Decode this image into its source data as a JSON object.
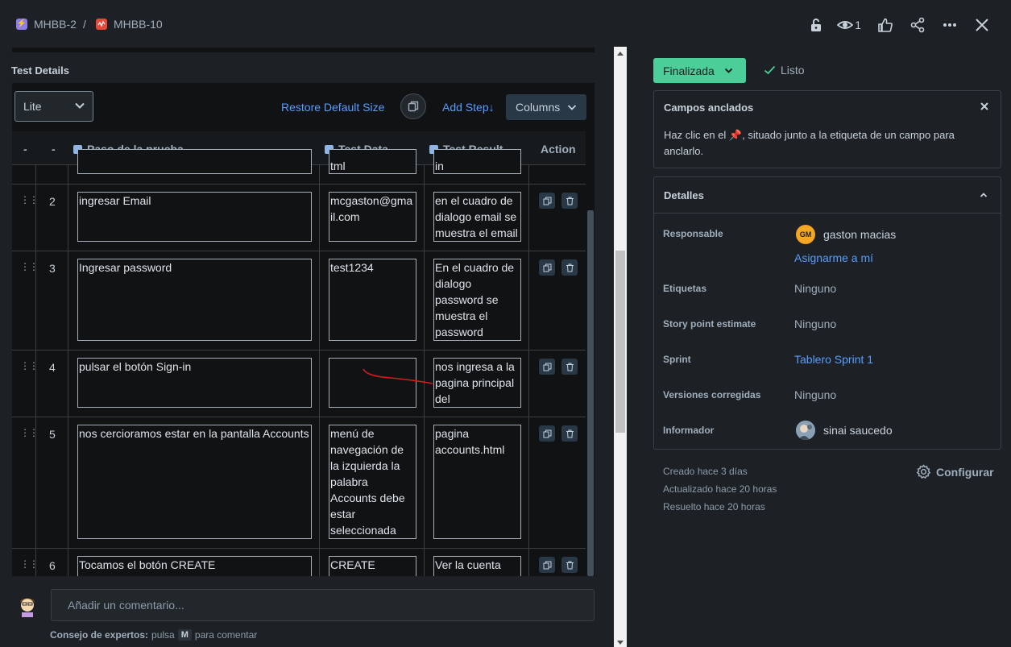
{
  "breadcrumb": {
    "parent": "MHBB-2",
    "separator": "/",
    "current": "MHBB-10",
    "parent_icon": "epic-lightning-icon",
    "current_icon": "bug-icon"
  },
  "top_actions": {
    "watch_count": "1"
  },
  "test_details": {
    "title": "Test Details",
    "view_select": "Lite",
    "restore_label": "Restore Default Size",
    "add_step_label": "Add Step↓",
    "columns_label": "Columns",
    "headers": {
      "col_drag": "-",
      "col_num": "-",
      "step": "Paso de la prueba",
      "data": "Test Data",
      "result": "Test Result",
      "action": "Action"
    },
    "partial_row": {
      "data": "tml",
      "result": "in"
    },
    "rows": [
      {
        "num": "2",
        "step": "ingresar Email",
        "data": "mcgaston@gmail.com",
        "result": "en el cuadro de dialogo email se muestra el email"
      },
      {
        "num": "3",
        "step": "Ingresar password",
        "data": "test1234",
        "result": "En el cuadro de dialogo password se muestra el password"
      },
      {
        "num": "4",
        "step": "pulsar el botón Sign-in",
        "data": "",
        "result": "nos ingresa a la pagina principal del homebanking"
      },
      {
        "num": "5",
        "step": "nos cercioramos estar en la pantalla Accounts",
        "data": "menú de navegación de la izquierda la palabra Accounts debe estar seleccionada",
        "result": "pagina accounts.html"
      },
      {
        "num": "6",
        "step": "Tocamos el botón CREATE",
        "data": "CREATE",
        "result": "Ver la cuenta"
      }
    ]
  },
  "comment": {
    "placeholder": "Añadir un comentario...",
    "tip_bold": "Consejo de expertos:",
    "tip_text": "pulsa",
    "tip_key": "M",
    "tip_after": "para comentar"
  },
  "status": {
    "label": "Finalizada",
    "resolution": "Listo",
    "color": "#4bce97"
  },
  "pinned": {
    "title": "Campos anclados",
    "text": "Haz clic en el 📌, situado junto a la etiqueta de un campo para anclarlo."
  },
  "details": {
    "title": "Detalles",
    "fields": {
      "assignee_label": "Responsable",
      "assignee_initials": "GM",
      "assignee": "gaston macias",
      "assign_me": "Asignarme a mí",
      "labels_label": "Etiquetas",
      "labels": "Ninguno",
      "sp_label": "Story point estimate",
      "sp": "Ninguno",
      "sprint_label": "Sprint",
      "sprint": "Tablero Sprint 1",
      "fix_label": "Versiones corregidas",
      "fix": "Ninguno",
      "reporter_label": "Informador",
      "reporter": "sinai saucedo"
    }
  },
  "meta": {
    "created": "Creado hace 3 días",
    "updated": "Actualizado hace 20 horas",
    "resolved": "Resuelto hace 20 horas",
    "configure": "Configurar"
  }
}
